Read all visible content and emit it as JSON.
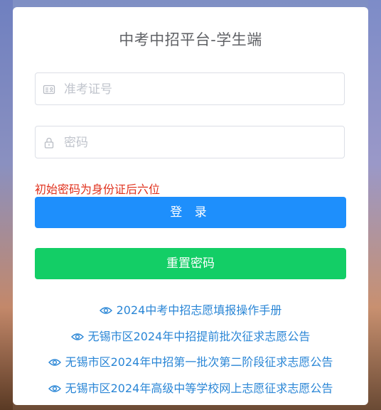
{
  "title": "中考中招平台-学生端",
  "form": {
    "ticket_placeholder": "准考证号",
    "password_placeholder": "密码",
    "hint": "初始密码为身份证后六位",
    "login_label": "登 录",
    "reset_label": "重置密码"
  },
  "links": [
    {
      "label": "2024中考中招志愿填报操作手册",
      "icon": "eye-icon"
    },
    {
      "label": "无锡市区2024年中招提前批次征求志愿公告",
      "icon": "eye-icon"
    },
    {
      "label": "无锡市区2024年中招第一批次第二阶段征求志愿公告",
      "icon": "eye-icon"
    },
    {
      "label": "无锡市区2024年高级中等学校网上志愿征求志愿公告",
      "icon": "eye-icon"
    }
  ],
  "colors": {
    "primary": "#1e8ffc",
    "success": "#13ce66",
    "hint": "#e0311d",
    "link": "#2a86d6"
  }
}
